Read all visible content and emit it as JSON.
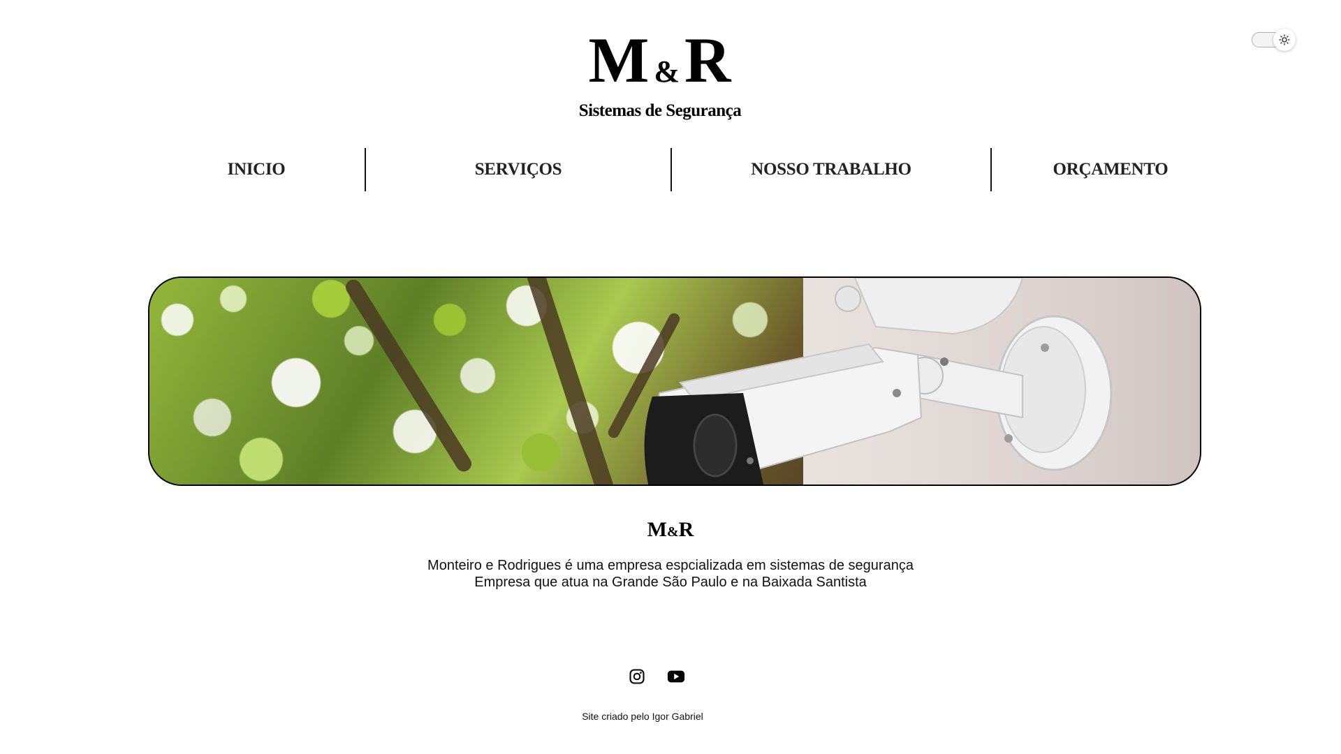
{
  "header": {
    "logo_mark_left": "M",
    "logo_mark_amp": "&",
    "logo_mark_right": "R",
    "logo_subtitle": "Sistemas de Segurança"
  },
  "theme_toggle": {
    "icon": "sun-icon",
    "state": "light"
  },
  "nav": {
    "items": [
      {
        "label": "INICIO"
      },
      {
        "label": "SERVIÇOS"
      },
      {
        "label": "NOSSO TRABALHO"
      },
      {
        "label": "ORÇAMENTO"
      }
    ]
  },
  "hero": {
    "image": "security-camera-on-wall-with-tree-background"
  },
  "about": {
    "title_left": "M",
    "title_amp": "&",
    "title_right": "R",
    "line1": "Monteiro e Rodrigues é uma empresa espcializada em sistemas de segurança",
    "line2": "Empresa que atua na Grande São Paulo e na Baixada Santista"
  },
  "social": {
    "links": [
      {
        "icon": "instagram-icon"
      },
      {
        "icon": "youtube-icon"
      }
    ]
  },
  "footer": {
    "credit": "Site criado pelo Igor Gabriel"
  },
  "colors": {
    "background": "#ffffff",
    "text": "#000000",
    "divider": "#111111"
  }
}
